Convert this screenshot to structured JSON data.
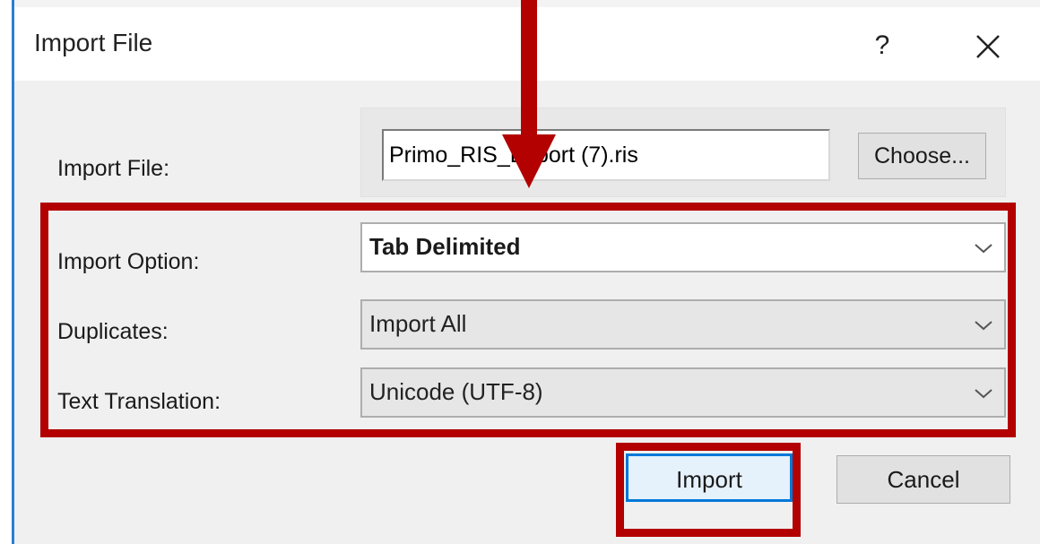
{
  "dialog": {
    "title": "Import File",
    "help_label": "?"
  },
  "form": {
    "import_file": {
      "label": "Import File:",
      "value": "Primo_RIS_Export (7).ris",
      "choose_label": "Choose..."
    },
    "import_option": {
      "label": "Import Option:",
      "selected": "Tab Delimited"
    },
    "duplicates": {
      "label": "Duplicates:",
      "selected": "Import All"
    },
    "text_translation": {
      "label": "Text Translation:",
      "selected": "Unicode (UTF-8)"
    }
  },
  "buttons": {
    "import_label": "Import",
    "cancel_label": "Cancel"
  },
  "colors": {
    "annotation": "#b30000",
    "focus_border": "#0078d7"
  },
  "icons": [
    "close-icon",
    "chevron-down-icon",
    "annotation-arrow"
  ]
}
